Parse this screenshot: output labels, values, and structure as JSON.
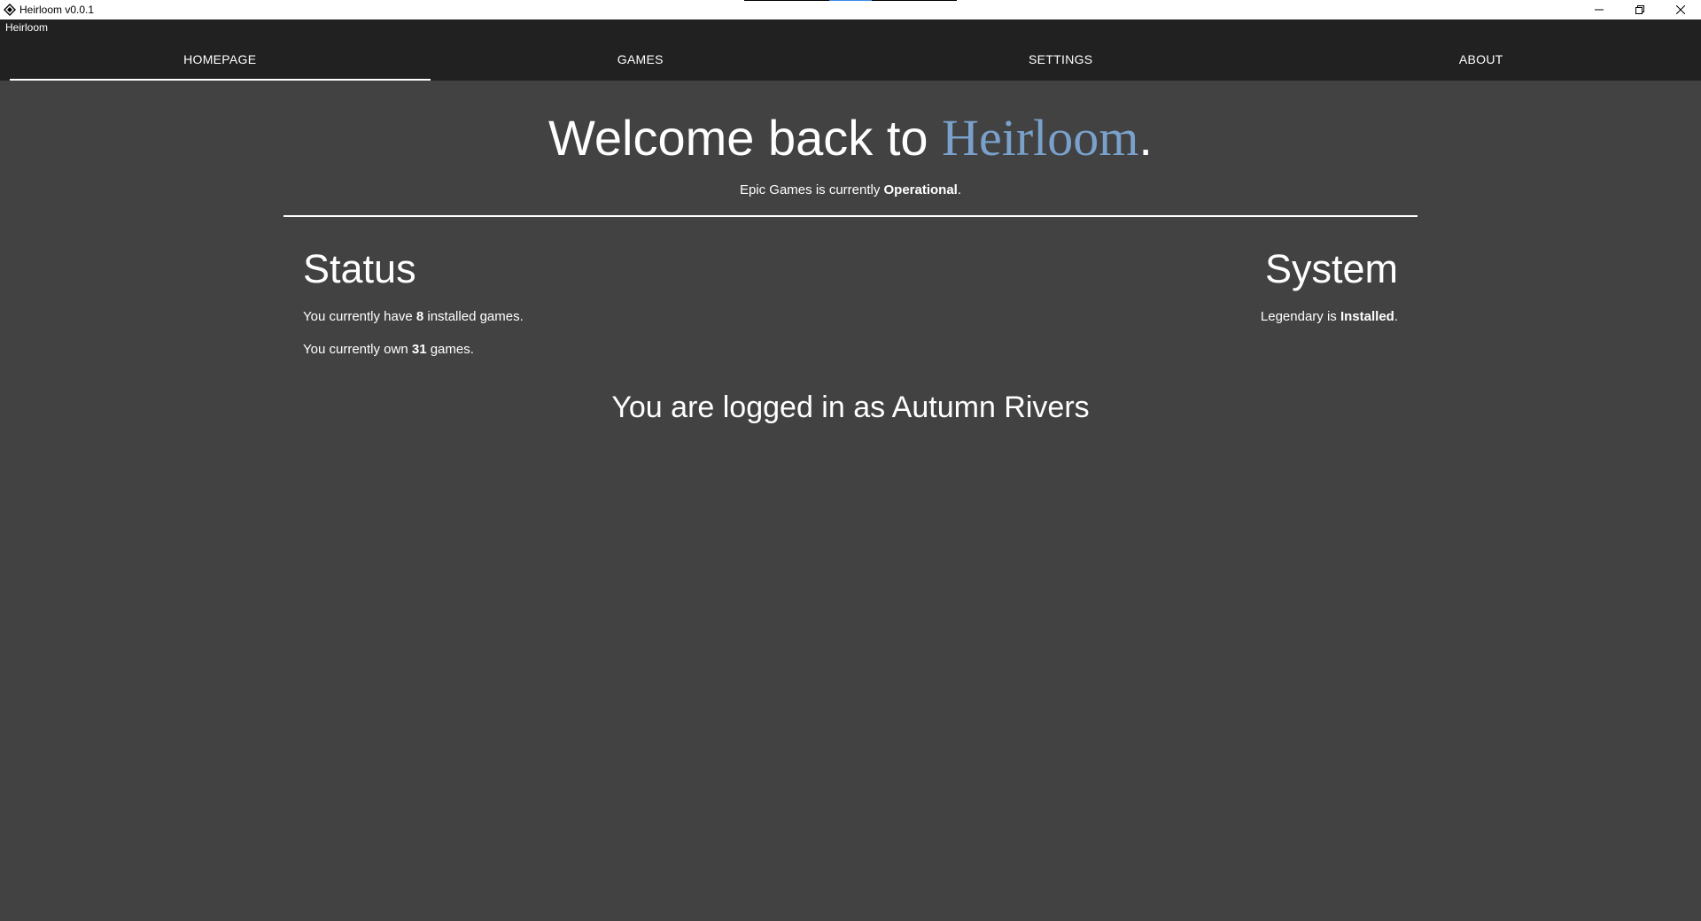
{
  "window": {
    "title": "Heirloom v0.0.1",
    "app_icon": "heirloom-diamond-icon",
    "controls": [
      "minimize-icon",
      "restore-icon",
      "close-icon"
    ]
  },
  "appbar": {
    "app_name": "Heirloom"
  },
  "tabs": [
    {
      "label": "HOMEPAGE",
      "active": true
    },
    {
      "label": "GAMES",
      "active": false
    },
    {
      "label": "SETTINGS",
      "active": false
    },
    {
      "label": "ABOUT",
      "active": false
    }
  ],
  "home": {
    "welcome_prefix": "Welcome back to ",
    "welcome_brand": "Heirloom",
    "welcome_suffix": ".",
    "service_prefix": "Epic Games is currently ",
    "service_status": "Operational",
    "service_suffix": ".",
    "status": {
      "heading": "Status",
      "installed_prefix": "You currently have ",
      "installed_count": "8",
      "installed_suffix": " installed games.",
      "owned_prefix": "You currently own ",
      "owned_count": "31",
      "owned_suffix": " games."
    },
    "system": {
      "heading": "System",
      "legendary_prefix": "Legendary is ",
      "legendary_status": "Installed",
      "legendary_suffix": "."
    },
    "logged_in": "You are logged in as Autumn Rivers"
  },
  "colors": {
    "background": "#424242",
    "appbar": "#212121",
    "brand_accent": "#7aa1cc",
    "text": "#ffffff"
  }
}
